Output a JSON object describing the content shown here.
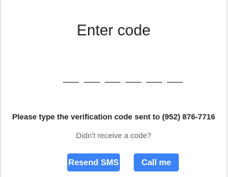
{
  "dialog": {
    "title": "Enter code",
    "code_slots": 6,
    "instruction": "Please type the verification code sent to (952) 876-7716",
    "no_code_text": "Didn't receive a code?",
    "resend_label": "Resend SMS",
    "call_label": "Call me"
  },
  "colors": {
    "button_background": "#3b82f6",
    "button_text": "#ffffff",
    "title_text": "#202124",
    "muted_text": "#5f6368"
  }
}
